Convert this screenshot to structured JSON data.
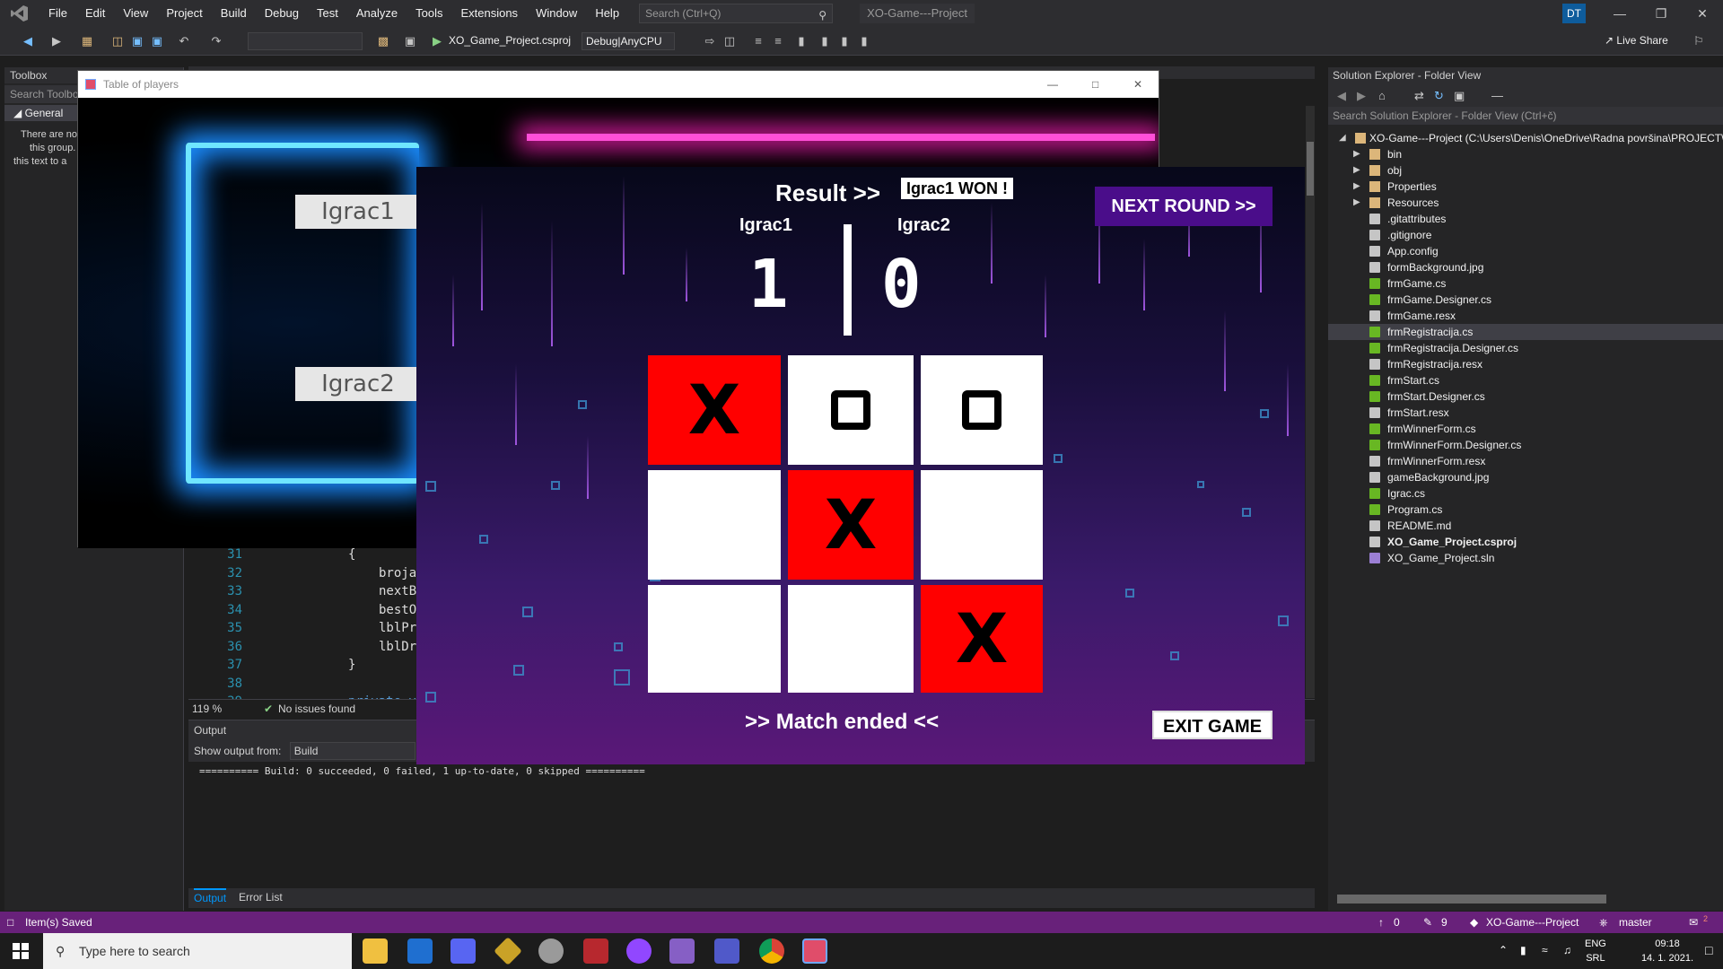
{
  "menu": {
    "items": [
      "File",
      "Edit",
      "View",
      "Project",
      "Build",
      "Debug",
      "Test",
      "Analyze",
      "Tools",
      "Extensions",
      "Window",
      "Help"
    ],
    "search_placeholder": "Search (Ctrl+Q)",
    "window_title": "XO-Game---Project",
    "user_initials": "DT"
  },
  "toolbar": {
    "project_combo": "XO_Game_Project.csproj",
    "config_combo": "Debug|AnyCPU",
    "live_share": "Live Share"
  },
  "toolbox": {
    "title": "Toolbox",
    "search_placeholder": "Search Toolbo",
    "group": "General",
    "empty_line1": "There are no",
    "empty_line2": "this group.",
    "empty_line3": "this text to a"
  },
  "editor": {
    "lines": [
      {
        "num": "31",
        "code": "{"
      },
      {
        "num": "32",
        "code": "broja"
      },
      {
        "num": "33",
        "code": "nextB"
      },
      {
        "num": "34",
        "code": "bestO"
      },
      {
        "num": "35",
        "code": "lblPr"
      },
      {
        "num": "36",
        "code": "lblDr"
      },
      {
        "num": "37",
        "code": "}"
      },
      {
        "num": "38",
        "code": ""
      },
      {
        "num": "39",
        "code": "private v"
      }
    ],
    "zoom": "119 %",
    "issues": "No issues found"
  },
  "output": {
    "title": "Output",
    "show_from_label": "Show output from:",
    "show_from_value": "Build",
    "text": "========== Build: 0 succeeded, 0 failed, 1 up-to-date, 0 skipped ==========",
    "tabs": [
      "Output",
      "Error List"
    ]
  },
  "solution": {
    "title": "Solution Explorer - Folder View",
    "search_placeholder": "Search Solution Explorer - Folder View (Ctrl+č)",
    "root": "XO-Game---Project (C:\\Users\\Denis\\OneDrive\\Radna površina\\PROJECT\\",
    "items": [
      {
        "label": "bin",
        "type": "folder"
      },
      {
        "label": "obj",
        "type": "folder"
      },
      {
        "label": "Properties",
        "type": "folder"
      },
      {
        "label": "Resources",
        "type": "folder"
      },
      {
        "label": ".gitattributes",
        "type": "file"
      },
      {
        "label": ".gitignore",
        "type": "file"
      },
      {
        "label": "App.config",
        "type": "config"
      },
      {
        "label": "formBackground.jpg",
        "type": "image"
      },
      {
        "label": "frmGame.cs",
        "type": "cs"
      },
      {
        "label": "frmGame.Designer.cs",
        "type": "cs"
      },
      {
        "label": "frmGame.resx",
        "type": "resx"
      },
      {
        "label": "frmRegistracija.cs",
        "type": "cs"
      },
      {
        "label": "frmRegistracija.Designer.cs",
        "type": "cs"
      },
      {
        "label": "frmRegistracija.resx",
        "type": "resx"
      },
      {
        "label": "frmStart.cs",
        "type": "cs"
      },
      {
        "label": "frmStart.Designer.cs",
        "type": "cs"
      },
      {
        "label": "frmStart.resx",
        "type": "resx"
      },
      {
        "label": "frmWinnerForm.cs",
        "type": "cs"
      },
      {
        "label": "frmWinnerForm.Designer.cs",
        "type": "cs"
      },
      {
        "label": "frmWinnerForm.resx",
        "type": "resx"
      },
      {
        "label": "gameBackground.jpg",
        "type": "image"
      },
      {
        "label": "Igrac.cs",
        "type": "cs"
      },
      {
        "label": "Program.cs",
        "type": "cs"
      },
      {
        "label": "README.md",
        "type": "md"
      },
      {
        "label": "XO_Game_Project.csproj",
        "type": "csproj"
      },
      {
        "label": "XO_Game_Project.sln",
        "type": "sln"
      }
    ]
  },
  "statusbar": {
    "left": "Item(s) Saved",
    "up_count": "0",
    "edit_count": "9",
    "repo": "XO-Game---Project",
    "branch": "master",
    "notif_count": "2"
  },
  "taskbar": {
    "search_placeholder": "Type here to search",
    "lang1": "ENG",
    "lang2": "SRL",
    "time": "09:18",
    "date": "14. 1. 2021."
  },
  "players_window": {
    "title": "Table of players",
    "player1": "Igrac1",
    "player2": "Igrac2"
  },
  "game": {
    "result_label": "Result >>",
    "result_value": "Igrac1 WON !",
    "next_round": "NEXT ROUND >>",
    "player1_name": "Igrac1",
    "player2_name": "Igrac2",
    "player1_score": "1",
    "player2_score": "0",
    "board": [
      "X",
      "O",
      "O",
      "",
      "X",
      "",
      "",
      "",
      "X"
    ],
    "winning_cells": [
      0,
      4,
      8
    ],
    "match_ended": ">> Match ended <<",
    "exit": "EXIT GAME"
  }
}
